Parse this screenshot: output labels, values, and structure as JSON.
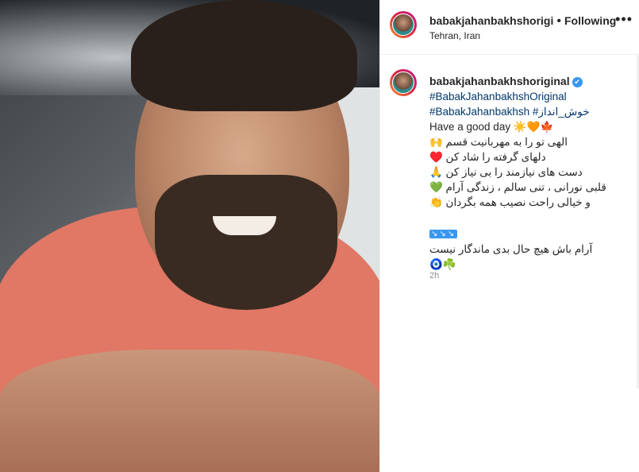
{
  "post": {
    "username": "babakjahanbakhshoriginal",
    "username_header": "babakjahanbakhshorigi",
    "follow_status": "Following",
    "location": "Tehran, Iran",
    "verified_icon": "verified-badge-icon",
    "more_icon": "more-options-icon"
  },
  "caption": {
    "hashtag1": "#BabakJahanbakhshOriginal",
    "hashtag2": "#BabakJahanbakhsh",
    "hashtag3": "#خوش_انداز",
    "line_en": "Have a good day ☀️🧡🍁",
    "line1": "الهی تو را به مهربانیت قسم 🙌",
    "line2": "دلهای گرفته را شاد کن ♥️",
    "line3": "دست های نیازمند را بی نیاز کن 🙏",
    "line4": "قلبی نورانی ، تنی سالم ، زندگی آرام 💚",
    "line5": "و خیالی راحت نصیب همه بگردان 👏",
    "arrows": "↘↘↘",
    "line6": "آرام باش هیچ حال بدی ماندگار نیست",
    "line7": "🧿☘️",
    "timestamp": "2h"
  }
}
